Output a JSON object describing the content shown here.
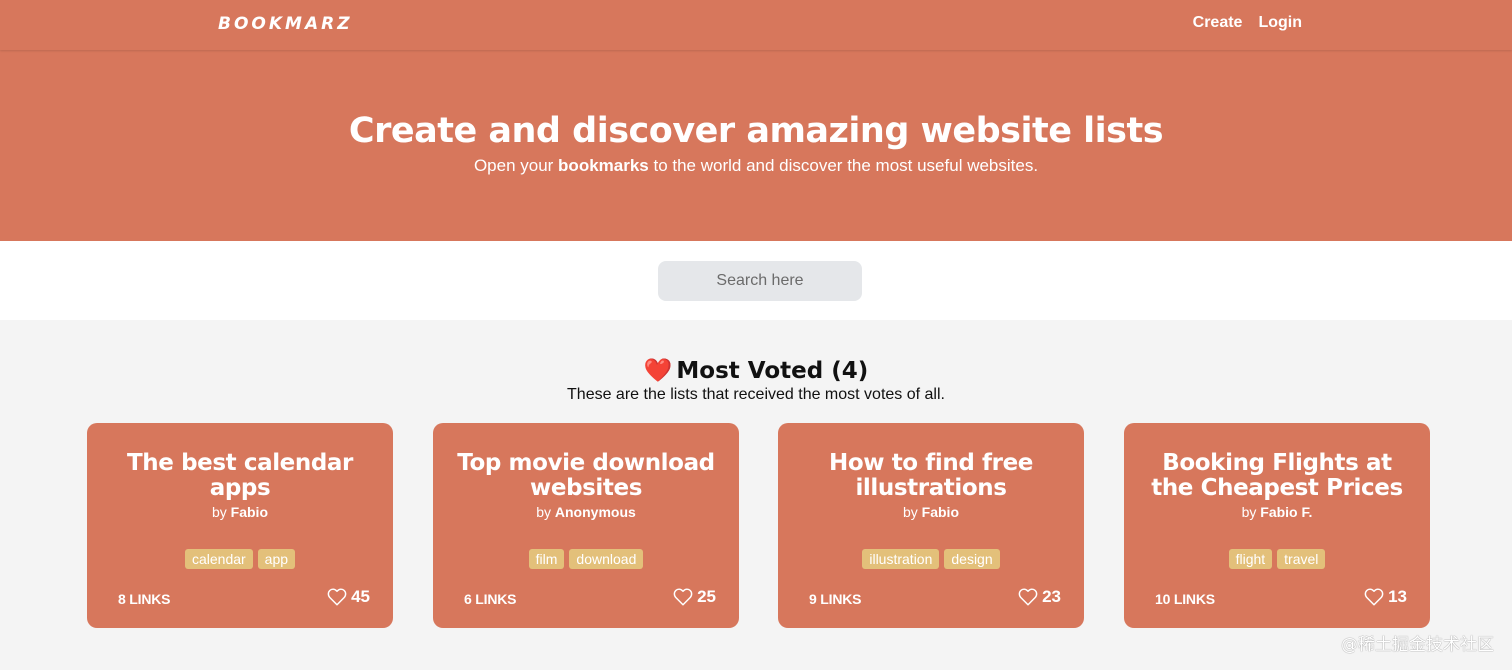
{
  "header": {
    "logo": "BOOKMARZ",
    "nav": [
      {
        "label": "Create"
      },
      {
        "label": "Login"
      }
    ]
  },
  "hero": {
    "title": "Create and discover amazing website lists",
    "subtitle_before": "Open your ",
    "subtitle_bold": "bookmarks",
    "subtitle_after": " to the world and discover the most useful websites."
  },
  "search": {
    "placeholder": "Search here",
    "value": ""
  },
  "section": {
    "emoji": "❤️",
    "title": "Most Voted (4)",
    "subtitle": "These are the lists that received the most votes of all."
  },
  "cards": [
    {
      "title": "The best calendar apps",
      "by_prefix": "by",
      "author": "Fabio",
      "tags": [
        "calendar",
        "app"
      ],
      "links": "8 LINKS",
      "votes": "45",
      "heart_icon": "heart-outline-icon"
    },
    {
      "title": "Top movie download websites",
      "by_prefix": "by",
      "author": "Anonymous",
      "tags": [
        "film",
        "download"
      ],
      "links": "6 LINKS",
      "votes": "25",
      "heart_icon": "heart-outline-icon"
    },
    {
      "title": "How to find free illustrations",
      "by_prefix": "by",
      "author": "Fabio",
      "tags": [
        "illustration",
        "design"
      ],
      "links": "9 LINKS",
      "votes": "23",
      "heart_icon": "heart-outline-icon"
    },
    {
      "title": "Booking Flights at the Cheapest Prices",
      "by_prefix": "by",
      "author": "Fabio F.",
      "tags": [
        "flight",
        "travel"
      ],
      "links": "10 LINKS",
      "votes": "13",
      "heart_icon": "heart-outline-icon"
    }
  ],
  "watermark": "@稀土掘金技术社区",
  "colors": {
    "brand": "#d7775c",
    "tag": "#e3c07a",
    "search_bg": "#e5e7ea",
    "page_bg": "#f4f4f4"
  }
}
